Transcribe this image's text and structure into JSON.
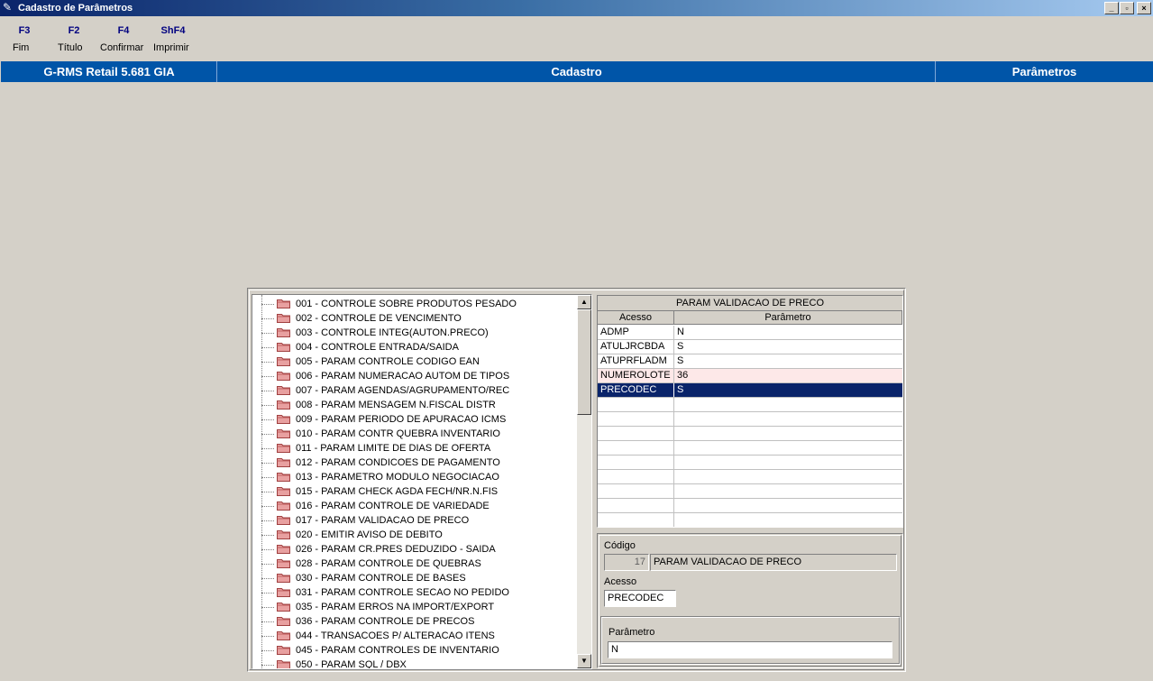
{
  "window": {
    "title": "Cadastro de Parâmetros",
    "buttons": [
      "_",
      "▫",
      "×"
    ]
  },
  "toolbar": [
    {
      "key": "F3",
      "label": "Fim"
    },
    {
      "key": "F2",
      "label": "Título"
    },
    {
      "key": "F4",
      "label": "Confirmar"
    },
    {
      "key": "ShF4",
      "label": "Imprimir"
    }
  ],
  "header": {
    "app": "G-RMS Retail 5.681 GIA",
    "module": "Cadastro",
    "screen": "Parâmetros",
    "color": "#0055a8"
  },
  "tree": {
    "folder_color": "#e8a0a0",
    "items": [
      "001 - CONTROLE SOBRE PRODUTOS PESADO",
      "002 - CONTROLE DE VENCIMENTO",
      "003 - CONTROLE INTEG(AUTON.PRECO)",
      "004 - CONTROLE ENTRADA/SAIDA",
      "005 - PARAM CONTROLE CODIGO EAN",
      "006 - PARAM NUMERACAO AUTOM DE TIPOS",
      "007 - PARAM AGENDAS/AGRUPAMENTO/REC",
      "008 - PARAM MENSAGEM N.FISCAL DISTR",
      "009 - PARAM PERIODO DE APURACAO ICMS",
      "010 - PARAM CONTR QUEBRA INVENTARIO",
      "011 - PARAM LIMITE DE DIAS DE OFERTA",
      "012 - PARAM CONDICOES DE PAGAMENTO",
      "013 - PARAMETRO MODULO NEGOCIACAO",
      "015 - PARAM CHECK AGDA FECH/NR.N.FIS",
      "016 - PARAM CONTROLE DE VARIEDADE",
      "017 - PARAM VALIDACAO DE PRECO",
      "020 - EMITIR AVISO DE DEBITO",
      "026 - PARAM CR.PRES DEDUZIDO - SAIDA",
      "028 - PARAM CONTROLE DE QUEBRAS",
      "030 - PARAM CONTROLE DE BASES",
      "031 - PARAM CONTROLE SECAO NO PEDIDO",
      "035 - PARAM ERROS NA IMPORT/EXPORT",
      "036 - PARAM CONTROLE DE PRECOS",
      "044 - TRANSACOES P/ ALTERACAO ITENS",
      "045 - PARAM CONTROLES DE INVENTARIO",
      "050 - PARAM SQL / DBX"
    ]
  },
  "grid": {
    "title": "PARAM VALIDACAO DE PRECO",
    "columns": [
      "Acesso",
      "Parâmetro"
    ],
    "rows": [
      {
        "acesso": "ADMP",
        "parametro": "N",
        "state": ""
      },
      {
        "acesso": "ATULJRCBDA",
        "parametro": "S",
        "state": ""
      },
      {
        "acesso": "ATUPRFLADM",
        "parametro": "S",
        "state": ""
      },
      {
        "acesso": "NUMEROLOTE",
        "parametro": "36",
        "state": "hl"
      },
      {
        "acesso": "PRECODEC",
        "parametro": "S",
        "state": "sel"
      },
      {
        "acesso": "",
        "parametro": "",
        "state": ""
      },
      {
        "acesso": "",
        "parametro": "",
        "state": ""
      },
      {
        "acesso": "",
        "parametro": "",
        "state": ""
      },
      {
        "acesso": "",
        "parametro": "",
        "state": ""
      },
      {
        "acesso": "",
        "parametro": "",
        "state": ""
      },
      {
        "acesso": "",
        "parametro": "",
        "state": ""
      },
      {
        "acesso": "",
        "parametro": "",
        "state": ""
      },
      {
        "acesso": "",
        "parametro": "",
        "state": ""
      },
      {
        "acesso": "",
        "parametro": "",
        "state": ""
      }
    ]
  },
  "detail": {
    "codigo_label": "Código",
    "codigo_value": "17",
    "codigo_desc": "PARAM VALIDACAO DE PRECO",
    "acesso_label": "Acesso",
    "acesso_value": "PRECODEC",
    "parametro_label": "Parâmetro",
    "parametro_value": "N"
  }
}
